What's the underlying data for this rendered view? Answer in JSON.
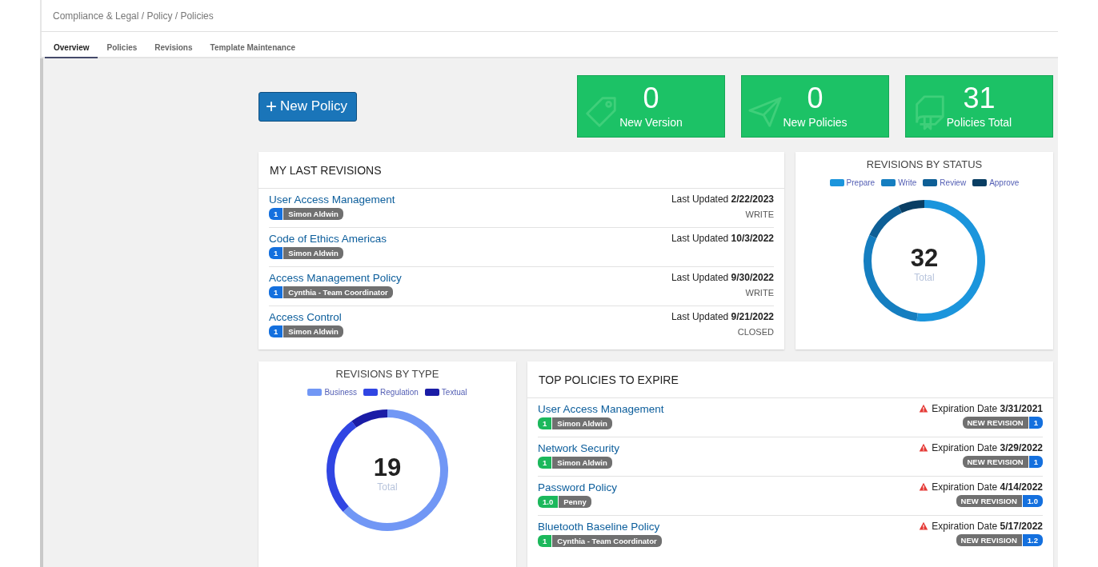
{
  "breadcrumb": "Compliance & Legal / Policy / Policies",
  "tabs": [
    {
      "label": "Overview",
      "selected": true
    },
    {
      "label": "Policies",
      "selected": false
    },
    {
      "label": "Revisions",
      "selected": false
    },
    {
      "label": "Template Maintenance",
      "selected": false
    }
  ],
  "new_button": {
    "icon": "+",
    "label": "New Policy"
  },
  "stats": [
    {
      "kind": "tag",
      "value": "0",
      "label": "New Version"
    },
    {
      "kind": "plane",
      "value": "0",
      "label": "New Policies"
    },
    {
      "kind": "book",
      "value": "31",
      "label": "Policies Total"
    }
  ],
  "last_revisions": {
    "title": "MY LAST REVISIONS",
    "rows": [
      {
        "name": "User Access Management",
        "version": "1",
        "owner": "Simon Aldwin",
        "updated": "Last Updated **2/22/2023**",
        "status": "WRITE"
      },
      {
        "name": "Code of Ethics Americas",
        "version": "1",
        "owner": "Simon Aldwin",
        "updated": "Last Updated **10/3/2022**"
      },
      {
        "name": "Access Management Policy",
        "version": "1",
        "owner": "Cynthia - Team Coordinator",
        "updated": "Last Updated **9/30/2022**",
        "status": "WRITE"
      },
      {
        "name": "Access Control",
        "version": "1",
        "owner": "Simon Aldwin",
        "updated": "Last Updated **9/21/2022**",
        "status": "CLOSED"
      }
    ]
  },
  "by_status": {
    "title": "REVISIONS BY STATUS",
    "total": "32",
    "total_label": "Total",
    "legend": [
      {
        "label": "Prepare",
        "color": "#1b95dc"
      },
      {
        "label": "Write",
        "color": "#157ec0"
      },
      {
        "label": "Review",
        "color": "#0e5f96"
      },
      {
        "label": "Approve",
        "color": "#093e63"
      }
    ]
  },
  "by_type": {
    "title": "REVISIONS BY TYPE",
    "total": "19",
    "total_label": "Total",
    "legend": [
      {
        "label": "Business",
        "color": "#7197f5"
      },
      {
        "label": "Regulation",
        "color": "#3045e3"
      },
      {
        "label": "Textual",
        "color": "#1a1ca6"
      }
    ]
  },
  "expire": {
    "title": "TOP POLICIES TO EXPIRE",
    "rows": [
      {
        "name": "User Access Management",
        "version": "1",
        "owner": "Simon Aldwin",
        "date": "Expiration Date **3/31/2021**",
        "action": "NEW REVISION",
        "new_version": "1"
      },
      {
        "name": "Network Security",
        "version": "1",
        "owner": "Simon Aldwin",
        "date": "Expiration Date **3/29/2022**",
        "action": "NEW REVISION",
        "new_version": "1"
      },
      {
        "name": "Password Policy",
        "version": "1.0",
        "owner": "Penny",
        "date": "Expiration Date **4/14/2022**",
        "action": "NEW REVISION",
        "new_version": "1.0"
      },
      {
        "name": "Bluetooth Baseline Policy",
        "version": "1",
        "owner": "Cynthia - Team Coordinator",
        "date": "Expiration Date **5/17/2022**",
        "action": "NEW REVISION",
        "new_version": "1.2"
      }
    ]
  }
}
